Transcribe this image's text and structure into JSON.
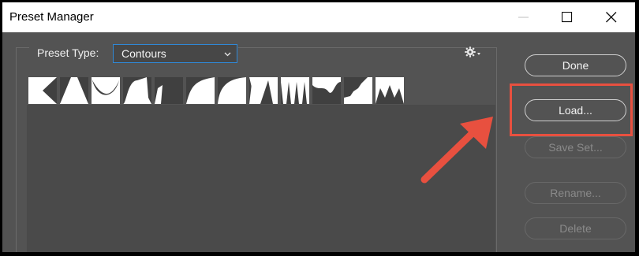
{
  "window": {
    "title": "Preset Manager",
    "controls": [
      "minimize-icon",
      "maximize-icon",
      "close-icon"
    ]
  },
  "preset": {
    "label": "Preset Type:",
    "selected": "Contours"
  },
  "buttons": {
    "done": "Done",
    "load": "Load...",
    "save_set": "Save Set...",
    "rename": "Rename...",
    "delete": "Delete"
  },
  "contours": [
    "linear",
    "cone",
    "cone-inverted",
    "cove-deep",
    "cove-shallow",
    "gaussian",
    "half-round",
    "ring",
    "ring-double",
    "rolling-slope",
    "rounded-steps",
    "sawtooth"
  ],
  "colors": {
    "panel": "#535353",
    "accent_highlight": "#e8503f",
    "focus_border": "#2f88d6"
  }
}
